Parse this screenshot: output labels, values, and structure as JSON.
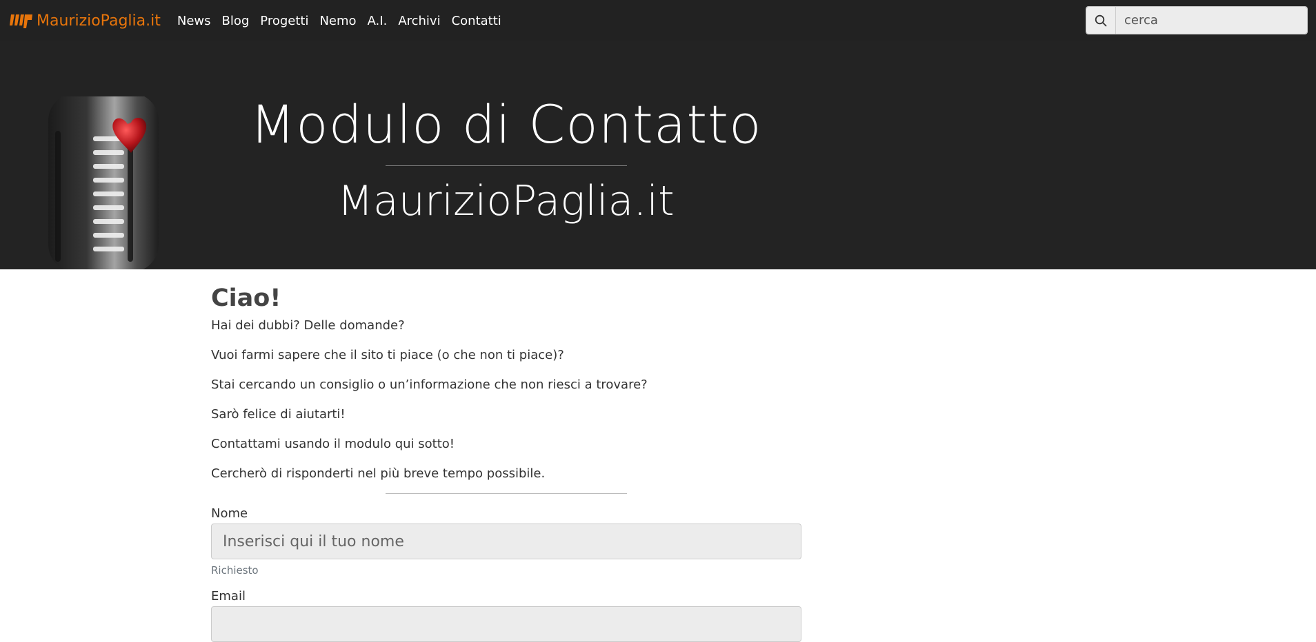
{
  "navbar": {
    "brand": "MaurizioPaglia.it",
    "links": [
      "News",
      "Blog",
      "Progetti",
      "Nemo",
      "A.I.",
      "Archivi",
      "Contatti"
    ],
    "search_placeholder": "cerca",
    "brand_color": "#e8750b"
  },
  "hero": {
    "title": "Modulo di Contatto",
    "subtitle": "MaurizioPaglia.it"
  },
  "content": {
    "greeting": "Ciao!",
    "paragraphs": [
      "Hai dei dubbi? Delle domande?",
      "Vuoi farmi sapere che il sito ti piace (o che non ti piace)?",
      "Stai cercando un consiglio o un’informazione che non riesci a trovare?",
      "Sarò felice di aiutarti!",
      "Contattami usando il modulo qui sotto!",
      "Cercherò di risponderti nel più breve tempo possibile."
    ]
  },
  "form": {
    "name_label": "Nome",
    "name_placeholder": "Inserisci qui il tuo nome",
    "name_help": "Richiesto",
    "email_label": "Email"
  }
}
